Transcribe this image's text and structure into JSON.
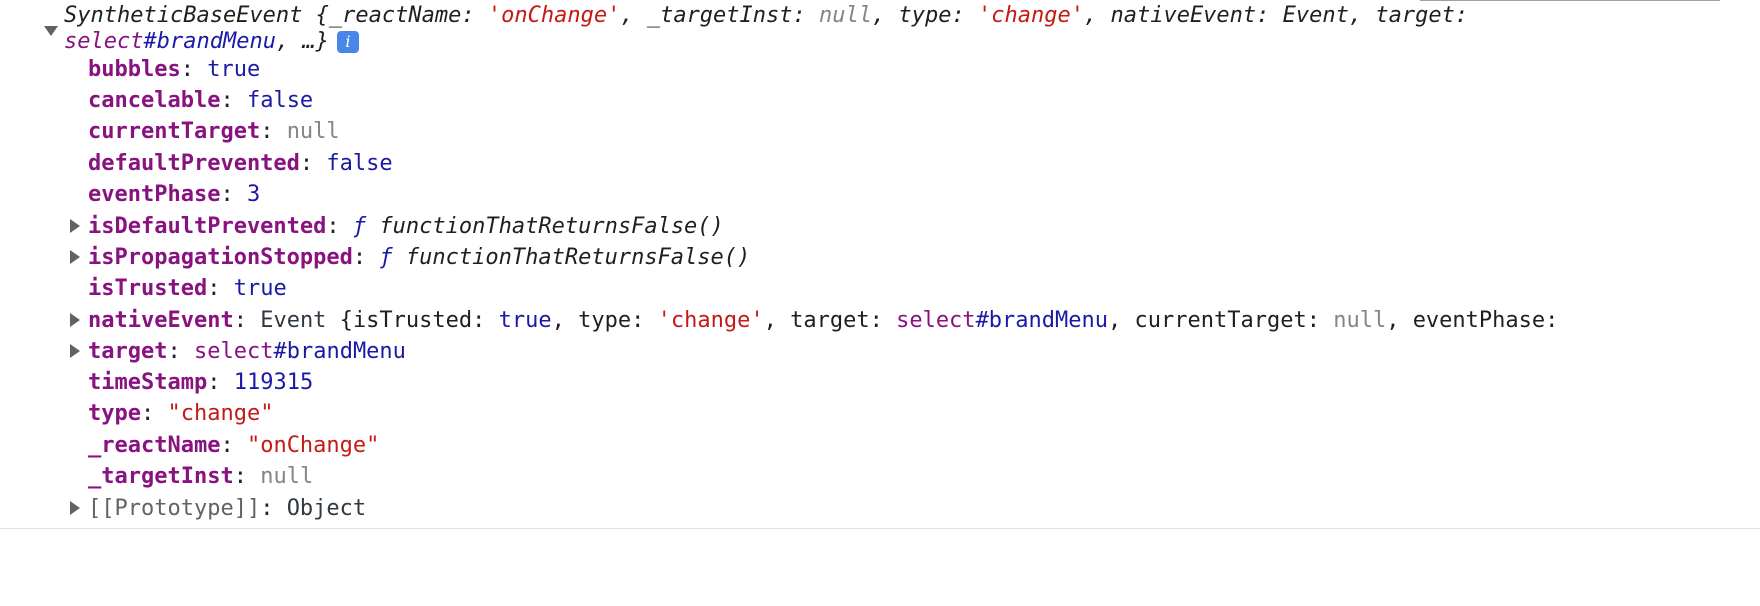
{
  "summary": {
    "class_name": "SyntheticBaseEvent",
    "open_brace": " {",
    "p1_key": "_reactName",
    "p1_val": "'onChange'",
    "p2_key": "_targetInst",
    "p2_val": "null",
    "p3_key": "type",
    "p3_val": "'change'",
    "p4_key": "nativeEvent",
    "p4_val": "Event",
    "p5_key": "target",
    "p5_val_tag": "select",
    "p5_val_id": "#brandMenu",
    "ellipsis": ", …}",
    "info_icon": "i"
  },
  "props": {
    "bubbles": {
      "key": "bubbles",
      "value": "true"
    },
    "cancelable": {
      "key": "cancelable",
      "value": "false"
    },
    "currentTarget": {
      "key": "currentTarget",
      "value": "null"
    },
    "defaultPrevented": {
      "key": "defaultPrevented",
      "value": "false"
    },
    "eventPhase": {
      "key": "eventPhase",
      "value": "3"
    },
    "isDefaultPrevented": {
      "key": "isDefaultPrevented",
      "fsym": "ƒ",
      "fname": "functionThatReturnsFalse()"
    },
    "isPropagationStopped": {
      "key": "isPropagationStopped",
      "fsym": "ƒ",
      "fname": "functionThatReturnsFalse()"
    },
    "isTrusted": {
      "key": "isTrusted",
      "value": "true"
    },
    "nativeEvent": {
      "key": "nativeEvent",
      "class_name": "Event",
      "open_brace": " {",
      "n1_key": "isTrusted",
      "n1_val": "true",
      "n2_key": "type",
      "n2_val": "'change'",
      "n3_key": "target",
      "n3_val_tag": "select",
      "n3_val_id": "#brandMenu",
      "n4_key": "currentTarget",
      "n4_val": "null",
      "n5_key": "eventPhase"
    },
    "target": {
      "key": "target",
      "value_tag": "select",
      "value_id": "#brandMenu"
    },
    "timeStamp": {
      "key": "timeStamp",
      "value": "119315"
    },
    "type": {
      "key": "type",
      "value": "\"change\""
    },
    "_reactName": {
      "key": "_reactName",
      "value": "\"onChange\""
    },
    "_targetInst": {
      "key": "_targetInst",
      "value": "null"
    },
    "prototype": {
      "key": "[[Prototype]]",
      "value": "Object"
    }
  }
}
